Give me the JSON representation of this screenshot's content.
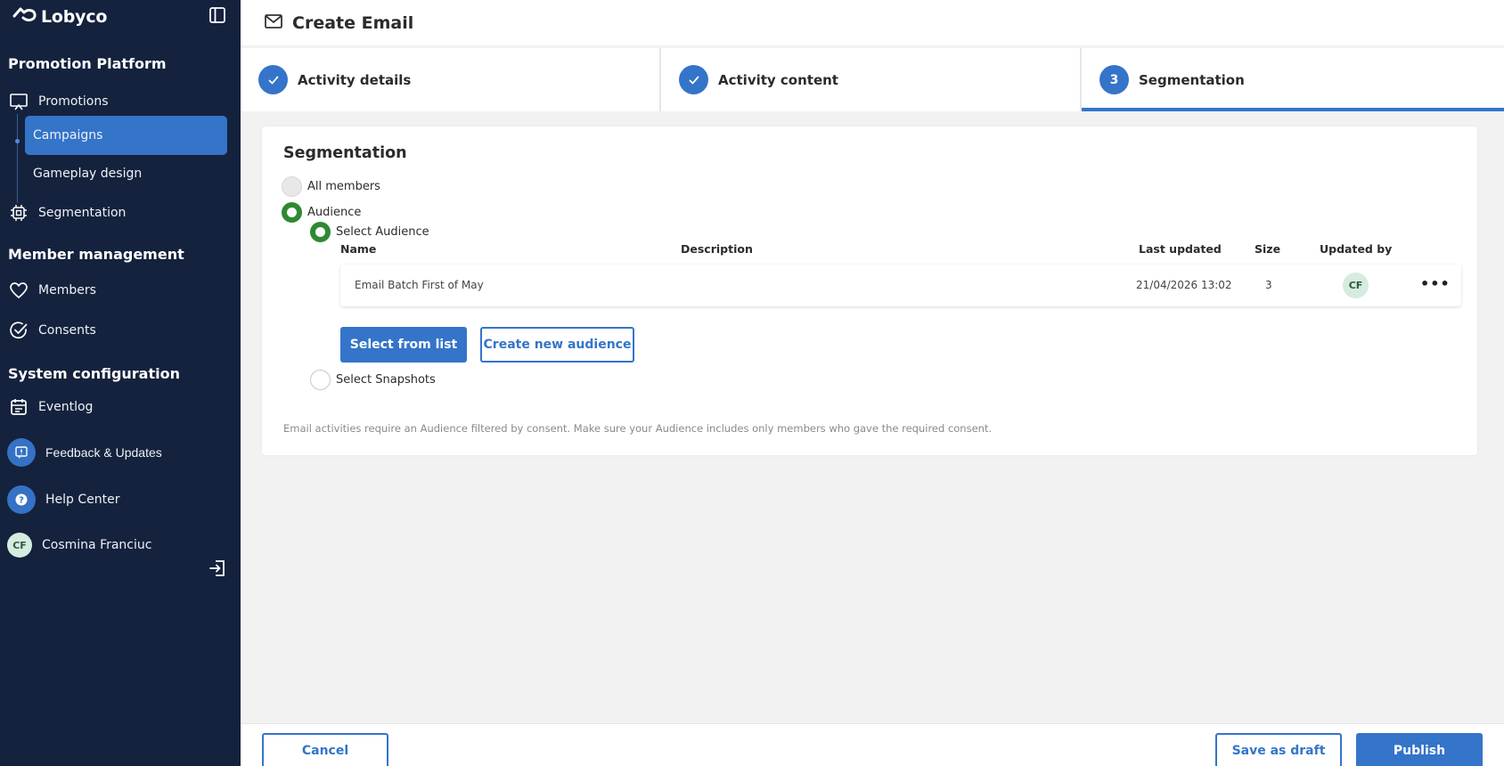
{
  "brand": {
    "name": "Lobyco"
  },
  "sidebar": {
    "sections": {
      "promotion": "Promotion Platform",
      "member": "Member management",
      "system": "System configuration"
    },
    "items": {
      "promotions": "Promotions",
      "campaigns": "Campaigns",
      "gameplay": "Gameplay design",
      "segmentation": "Segmentation",
      "members": "Members",
      "consents": "Consents",
      "eventlog": "Eventlog",
      "feedback": "Feedback & Updates",
      "help": "Help Center"
    },
    "user": {
      "initials": "CF",
      "name": "Cosmina Franciuc"
    }
  },
  "header": {
    "title": "Create Email"
  },
  "stepper": {
    "steps": [
      {
        "label": "Activity details",
        "status": "done"
      },
      {
        "label": "Activity content",
        "status": "done"
      },
      {
        "label": "Segmentation",
        "number": "3",
        "status": "active"
      }
    ]
  },
  "segmentation": {
    "title": "Segmentation",
    "options": {
      "all_members": "All members",
      "audience": "Audience",
      "select_audience": "Select Audience",
      "select_snapshots": "Select Snapshots"
    },
    "selected": "audience",
    "table": {
      "columns": {
        "name": "Name",
        "description": "Description",
        "last_updated": "Last updated",
        "size": "Size",
        "updated_by": "Updated by"
      },
      "rows": [
        {
          "name": "Email Batch First of May",
          "description": "",
          "last_updated": "21/04/2026 13:02",
          "size": "3",
          "updated_by": "CF"
        }
      ]
    },
    "buttons": {
      "select_from_list": "Select from list",
      "create_new": "Create new audience"
    },
    "hint": "Email activities require an Audience filtered by consent. Make sure your Audience includes only members who gave the required consent."
  },
  "footer": {
    "cancel": "Cancel",
    "save_draft": "Save as draft",
    "publish": "Publish"
  },
  "colors": {
    "sidebar_bg": "#14223d",
    "accent": "#3474c9",
    "radio_selected": "#2e8a32"
  }
}
